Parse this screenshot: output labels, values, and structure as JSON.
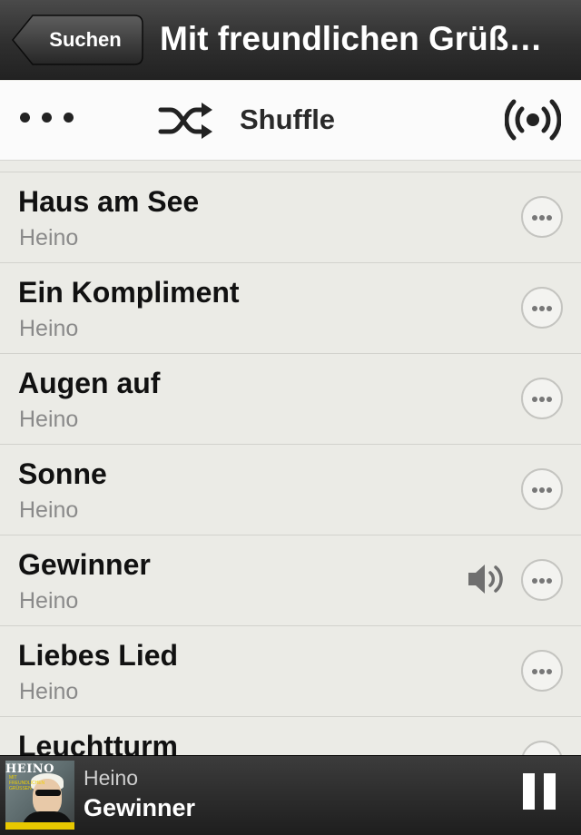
{
  "navbar": {
    "back_label": "Suchen",
    "title": "Mit freundlichen Grüß…"
  },
  "toolbar": {
    "more_icon": "more-dots-icon",
    "shuffle_label": "Shuffle",
    "shuffle_icon": "shuffle-icon",
    "broadcast_icon": "broadcast-icon"
  },
  "tracks": [
    {
      "title": "Haus am See",
      "artist": "Heino",
      "playing": false
    },
    {
      "title": "Ein Kompliment",
      "artist": "Heino",
      "playing": false
    },
    {
      "title": "Augen auf",
      "artist": "Heino",
      "playing": false
    },
    {
      "title": "Sonne",
      "artist": "Heino",
      "playing": false
    },
    {
      "title": "Gewinner",
      "artist": "Heino",
      "playing": true
    },
    {
      "title": "Liebes Lied",
      "artist": "Heino",
      "playing": false
    },
    {
      "title": "Leuchtturm",
      "artist": "",
      "playing": false
    }
  ],
  "now_playing": {
    "album_band": "HEINO",
    "album_subtitle": "MIT FREUNDLICHEN GRÜSSEN",
    "artist": "Heino",
    "title": "Gewinner",
    "state": "playing"
  }
}
